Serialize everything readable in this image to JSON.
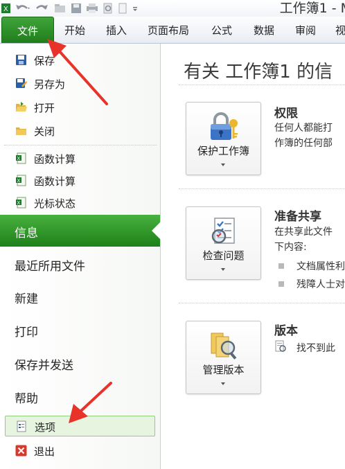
{
  "window": {
    "title": "工作簿1 - M"
  },
  "ribbon": {
    "tabs": [
      "文件",
      "开始",
      "插入",
      "页面布局",
      "公式",
      "数据",
      "审阅",
      "视"
    ]
  },
  "nav": {
    "commands_top": [
      {
        "label": "保存",
        "icon": "save-icon"
      },
      {
        "label": "另存为",
        "icon": "save-as-icon"
      },
      {
        "label": "打开",
        "icon": "open-folder-icon"
      },
      {
        "label": "关闭",
        "icon": "close-folder-icon"
      }
    ],
    "recent_files": [
      {
        "label": "函数计算",
        "icon": "excel-file-icon"
      },
      {
        "label": "函数计算",
        "icon": "excel-file-icon"
      },
      {
        "label": "光标状态",
        "icon": "excel-file-icon"
      }
    ],
    "sections": [
      "信息",
      "最近所用文件",
      "新建",
      "打印",
      "保存并发送",
      "帮助"
    ],
    "active_section": "信息",
    "commands_bottom": [
      {
        "label": "选项",
        "icon": "options-icon"
      },
      {
        "label": "退出",
        "icon": "exit-icon"
      }
    ]
  },
  "main": {
    "heading": "有关 工作簿1 的信",
    "permissions": {
      "button_label": "保护工作簿",
      "title": "权限",
      "lines": [
        "任何人都能打",
        "作簿的任何部"
      ]
    },
    "prepare": {
      "button_label": "检查问题",
      "title": "准备共享",
      "lines": [
        "在共享此文件",
        "下内容:"
      ],
      "bullets": [
        "文档属性利",
        "残障人士对"
      ]
    },
    "versions": {
      "button_label": "管理版本",
      "title": "版本",
      "text": "找不到此"
    }
  },
  "colors": {
    "accent": "#2a8f24",
    "accent_dark": "#1e8019",
    "annotation_arrow": "#e8332b"
  }
}
